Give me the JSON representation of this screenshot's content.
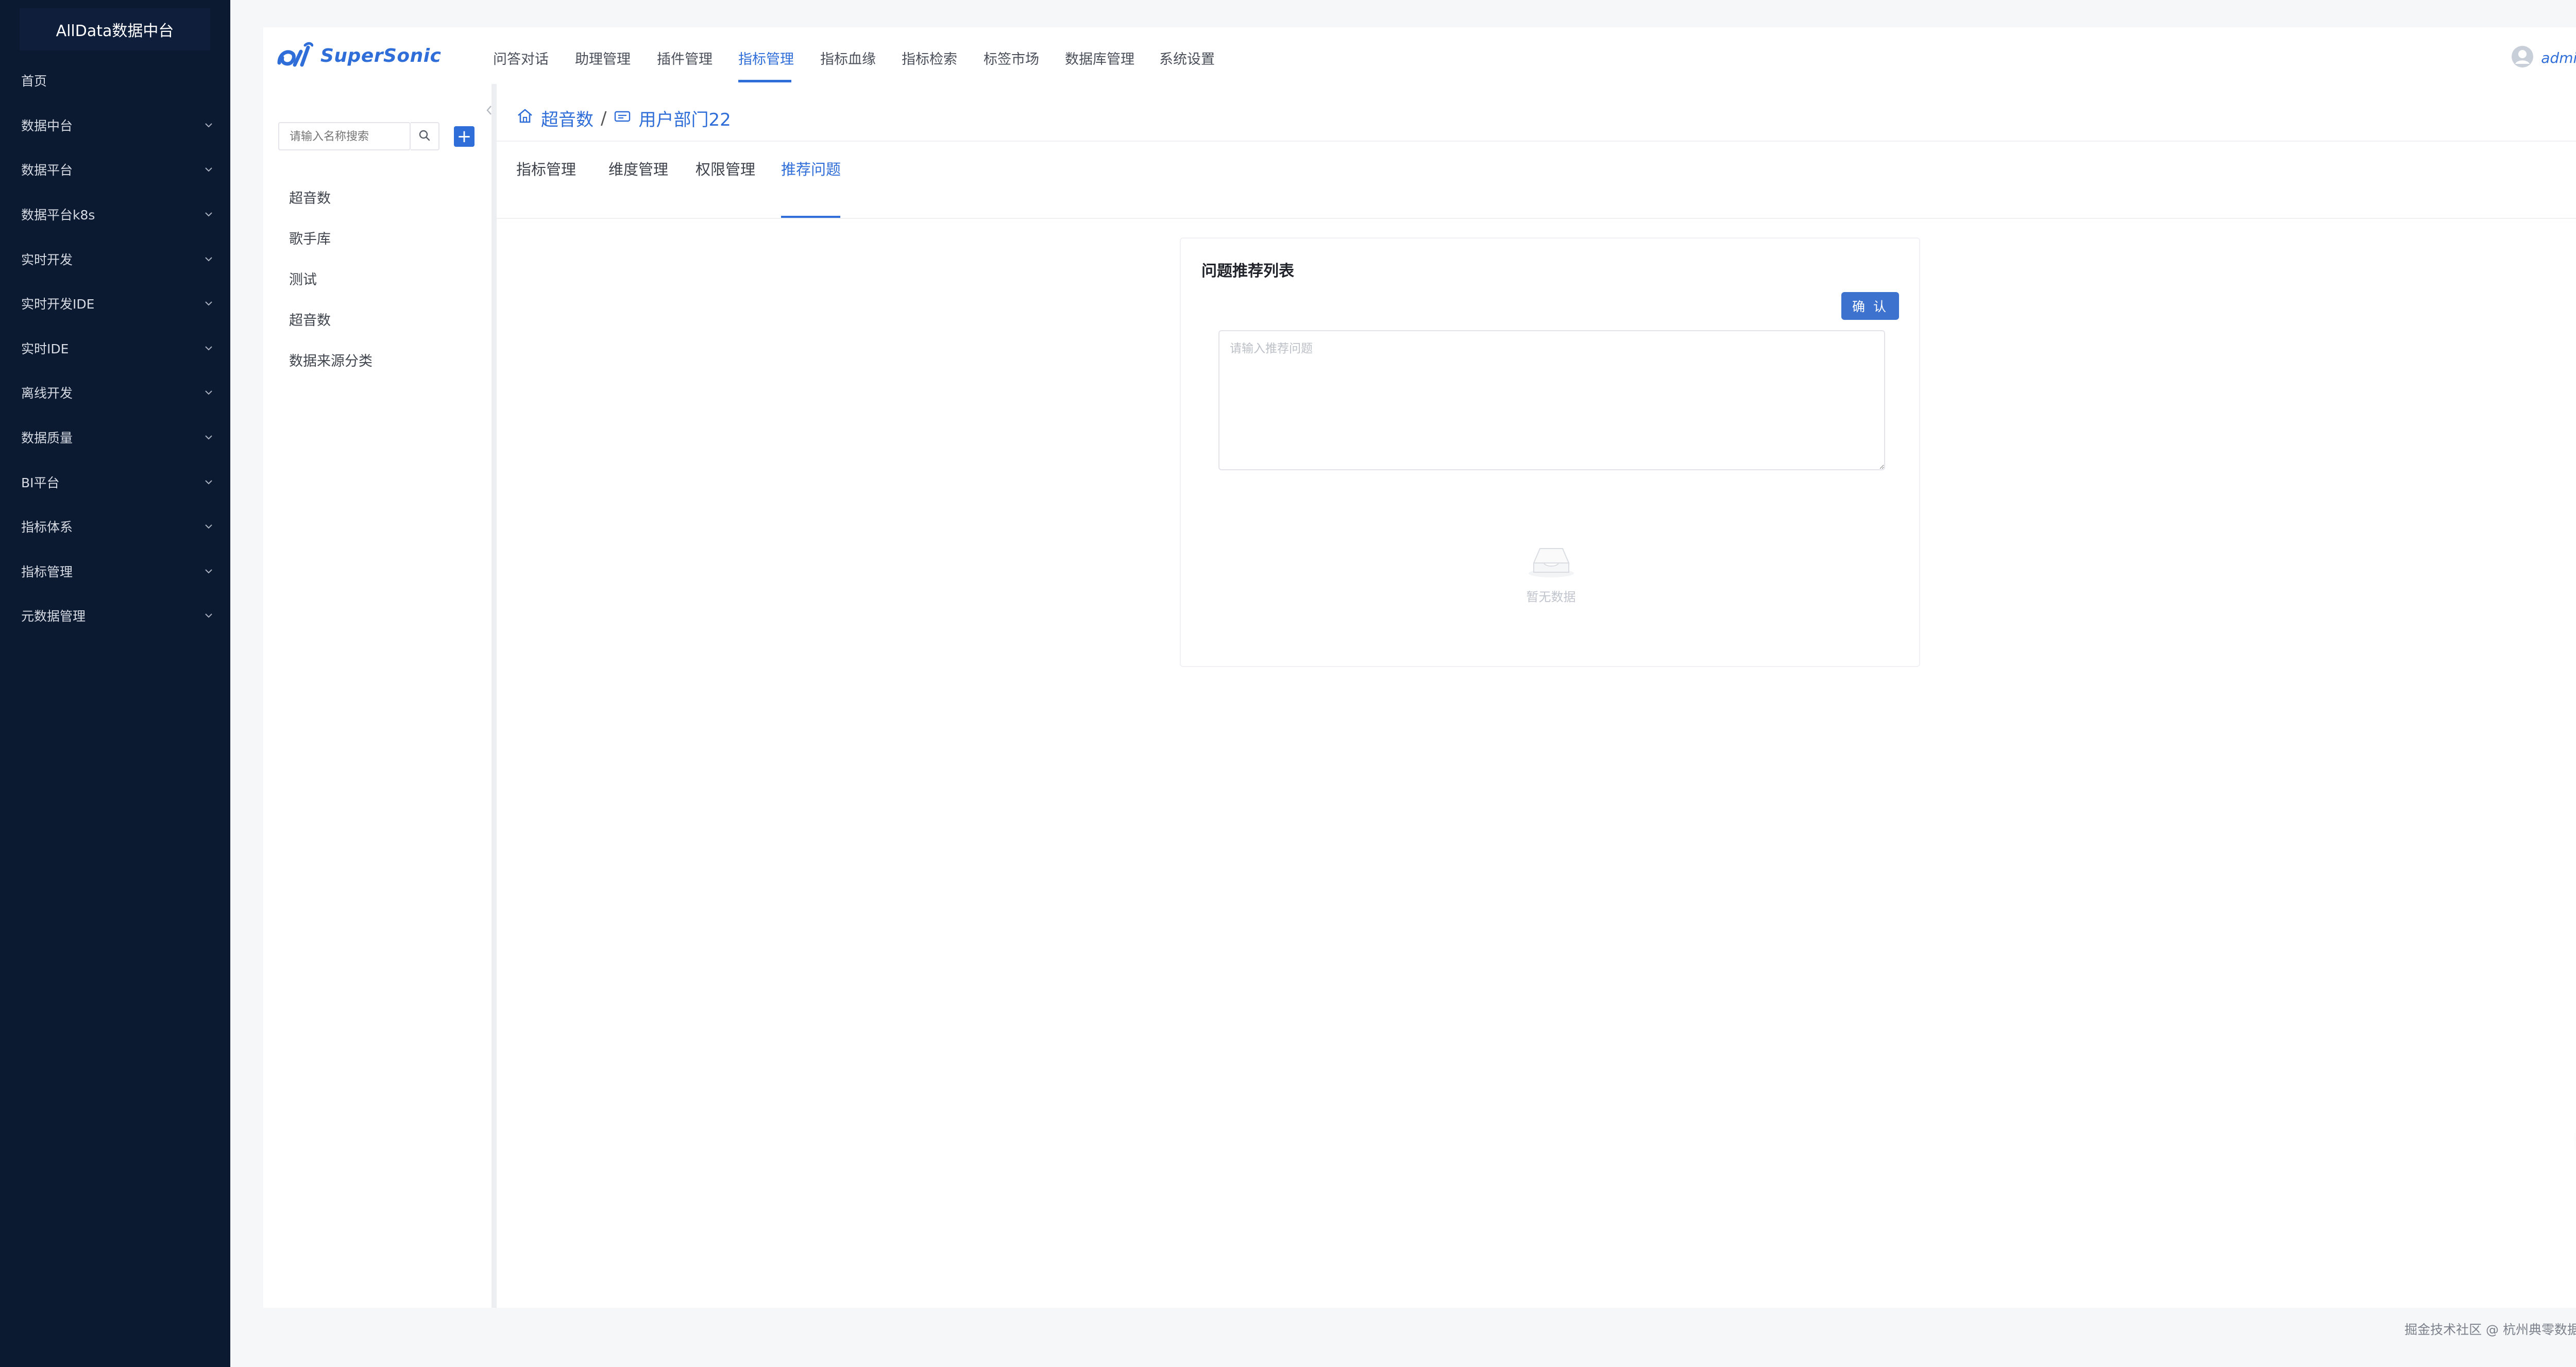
{
  "sidebar": {
    "logo": "AllData数据中台",
    "items": [
      {
        "label": "首页",
        "has_children": false
      },
      {
        "label": "数据中台",
        "has_children": true
      },
      {
        "label": "数据平台",
        "has_children": true
      },
      {
        "label": "数据平台k8s",
        "has_children": true
      },
      {
        "label": "实时开发",
        "has_children": true
      },
      {
        "label": "实时开发IDE",
        "has_children": true
      },
      {
        "label": "实时IDE",
        "has_children": true
      },
      {
        "label": "离线开发",
        "has_children": true
      },
      {
        "label": "数据质量",
        "has_children": true
      },
      {
        "label": "BI平台",
        "has_children": true
      },
      {
        "label": "指标体系",
        "has_children": true
      },
      {
        "label": "指标管理",
        "has_children": true
      },
      {
        "label": "元数据管理",
        "has_children": true
      }
    ]
  },
  "topnav": {
    "brand": "SuperSonic",
    "menu": [
      {
        "label": "问答对话",
        "active": false
      },
      {
        "label": "助理管理",
        "active": false
      },
      {
        "label": "插件管理",
        "active": false
      },
      {
        "label": "指标管理",
        "active": true
      },
      {
        "label": "指标血缘",
        "active": false
      },
      {
        "label": "指标检索",
        "active": false
      },
      {
        "label": "标签市场",
        "active": false
      },
      {
        "label": "数据库管理",
        "active": false
      },
      {
        "label": "系统设置",
        "active": false
      }
    ],
    "user": "admin"
  },
  "tree": {
    "search_placeholder": "请输入名称搜索",
    "add_label": "+",
    "items": [
      "超音数",
      "歌手库",
      "测试",
      "超音数",
      "数据来源分类"
    ]
  },
  "breadcrumb": {
    "root": "超音数",
    "separator": "/",
    "current": "用户部门22"
  },
  "tabs": [
    {
      "label": "指标管理",
      "active": false
    },
    {
      "label": "维度管理",
      "active": false
    },
    {
      "label": "权限管理",
      "active": false
    },
    {
      "label": "推荐问题",
      "active": true
    }
  ],
  "card": {
    "title": "问题推荐列表",
    "confirm_label": "确 认",
    "input_placeholder": "请输入推荐问题",
    "empty_text": "暂无数据"
  },
  "footer": {
    "text": "掘金技术社区 @ 杭州典零数据科技"
  },
  "colors": {
    "accent": "#2f6ed8",
    "sidebar_bg": "#0b1931",
    "float_button": "#2f5fe0"
  }
}
